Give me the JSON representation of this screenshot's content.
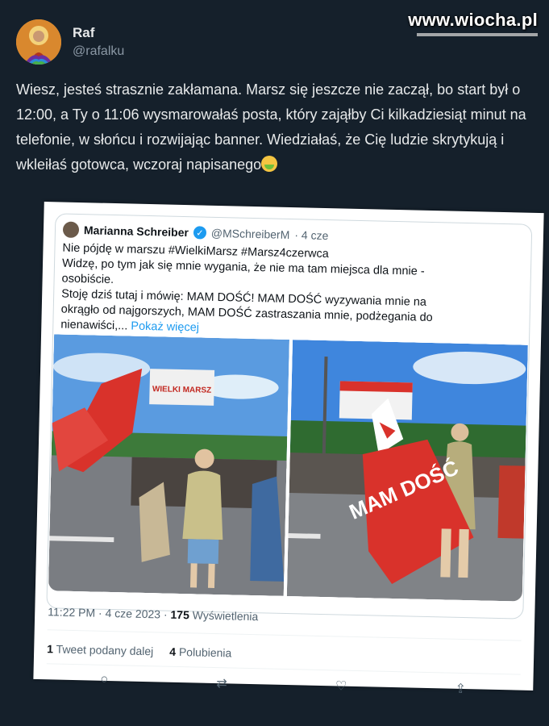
{
  "watermark": "www.wiocha.pl",
  "author": {
    "display_name": "Raf",
    "handle": "@rafalku",
    "avatar_icon": "saint-icon-avatar"
  },
  "tweet": {
    "text": "Wiesz, jesteś strasznie zakłamana. Marsz się jeszcze nie zaczął, bo start był o 12:00, a Ty o 11:06 wysmarowałaś posta, który zająłby Ci kilkadziesiąt minut na telefonie, w słońcu i rozwijając banner. Wiedziałaś, że Cię ludzie skrytykują i wkleiłaś gotowca, wczoraj napisanego",
    "emoji": "nauseated-face-emoji"
  },
  "quoted": {
    "name": "Marianna Schreiber",
    "handle": "@MSchreiberM",
    "time_ago": "· 4 cze",
    "lines": [
      "Nie pójdę w marszu #WielkiMarsz #Marsz4czerwca",
      "Widzę, po tym jak się mnie wygania, że nie ma tam miejsca dla mnie - osobiście.",
      "Stoję dziś tutaj i mówię: MAM DOŚĆ! MAM DOŚĆ  wyzywania mnie na okrągło od najgorszych, MAM DOŚĆ  zastraszania mnie, podżegania do nienawiści,..."
    ],
    "show_more": "Pokaż więcej",
    "photo_banner_1": "WIELKI MARSZ",
    "photo_flag_2": "MAM DOŚĆ",
    "timestamp": "11:22 PM · 4 cze 2023 ·",
    "views_count": "175",
    "views_label": "Wyświetlenia",
    "retweets_count": "1",
    "retweets_label": "Tweet podany dalej",
    "likes_count": "4",
    "likes_label": "Polubienia"
  },
  "colors": {
    "background": "#15202b",
    "accent": "#1d9bf0",
    "flag_red": "#d9322b"
  }
}
